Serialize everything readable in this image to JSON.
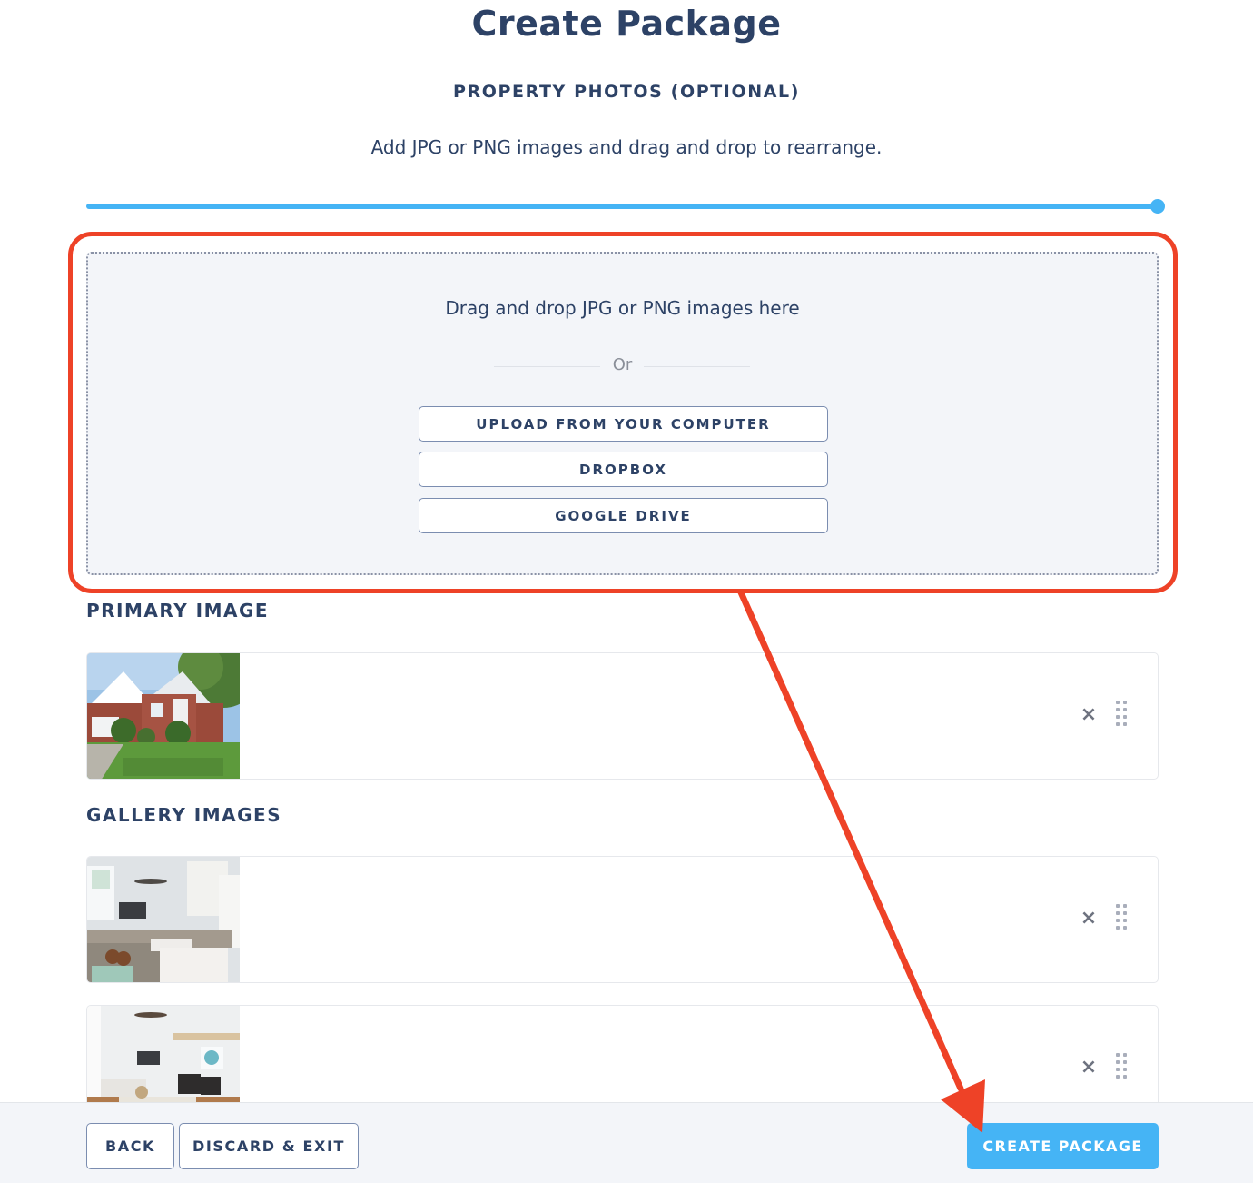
{
  "header": {
    "title": "Create Package",
    "section_title": "PROPERTY PHOTOS (OPTIONAL)",
    "subtitle": "Add JPG or PNG images and drag and drop to rearrange."
  },
  "progress": {
    "value_percent": 100
  },
  "dropzone": {
    "prompt": "Drag and drop JPG or PNG images here",
    "or_label": "Or",
    "buttons": [
      {
        "label": "UPLOAD FROM YOUR COMPUTER"
      },
      {
        "label": "DROPBOX"
      },
      {
        "label": "GOOGLE DRIVE"
      }
    ]
  },
  "primary_image": {
    "label": "PRIMARY IMAGE",
    "items": [
      {
        "thumbnail": "house-exterior-photo",
        "remove_icon": "close-icon",
        "drag_icon": "drag-handle-icon"
      }
    ]
  },
  "gallery_images": {
    "label": "GALLERY IMAGES",
    "items": [
      {
        "thumbnail": "kitchen-photo",
        "remove_icon": "close-icon",
        "drag_icon": "drag-handle-icon"
      },
      {
        "thumbnail": "living-room-photo",
        "remove_icon": "close-icon",
        "drag_icon": "drag-handle-icon"
      }
    ]
  },
  "footer": {
    "back_label": "BACK",
    "discard_label": "DISCARD & EXIT",
    "create_label": "CREATE PACKAGE"
  },
  "annotation": {
    "highlight_color": "#ee4227",
    "arrow_color": "#ee4227"
  },
  "colors": {
    "primary_text": "#2d4266",
    "accent": "#45b4f5",
    "dropzone_bg": "#f3f5f9"
  },
  "icons": {
    "remove": "×"
  }
}
